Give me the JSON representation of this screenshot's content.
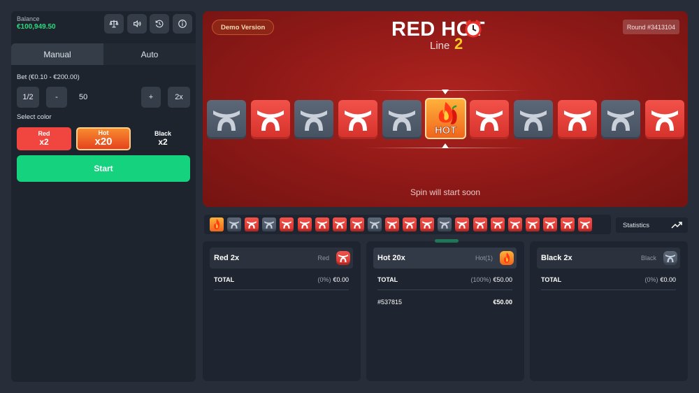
{
  "balance": {
    "label": "Balance",
    "value": "€100,949.50"
  },
  "toolbar": {
    "icons": [
      "scales-icon",
      "sound-icon",
      "history-icon",
      "info-icon"
    ]
  },
  "tabs": {
    "manual": "Manual",
    "auto": "Auto"
  },
  "bet": {
    "label": "Bet (€0.10 - €200.00)",
    "half": "1/2",
    "minus": "-",
    "value": "50",
    "plus": "+",
    "double": "2x"
  },
  "colors": {
    "label": "Select color",
    "red": {
      "name": "Red",
      "multiplier": "x2"
    },
    "hot": {
      "name": "Hot",
      "multiplier": "x20"
    },
    "black": {
      "name": "Black",
      "multiplier": "x2"
    }
  },
  "start_label": "Start",
  "game": {
    "demo_label": "Demo Version",
    "round_label": "Round #3413104",
    "logo_main": "RED HOT",
    "logo_sub": "Line",
    "logo_num": "2",
    "status": "Spin will start soon",
    "hot_text": "HOT",
    "reel": [
      "gray",
      "red",
      "gray",
      "red",
      "gray",
      "hot",
      "red",
      "gray",
      "red",
      "gray",
      "red"
    ],
    "palette": {
      "red": "#e53a32",
      "gray": "#525d6d",
      "hot": "#f58a25",
      "accent_green": "#14d27d"
    }
  },
  "history": [
    "hot",
    "gray",
    "red",
    "gray",
    "red",
    "red",
    "red",
    "red",
    "red",
    "gray",
    "red",
    "red",
    "red",
    "gray",
    "red",
    "red",
    "red",
    "red",
    "red",
    "red",
    "red",
    "red"
  ],
  "stats_label": "Statistics",
  "panels": {
    "red": {
      "title": "Red 2x",
      "tag": "Red",
      "total_label": "TOTAL",
      "total_pct": "(0%)",
      "total_amount": "€0.00"
    },
    "hot": {
      "title": "Hot 20x",
      "tag": "Hot(1)",
      "total_label": "TOTAL",
      "total_pct": "(100%)",
      "total_amount": "€50.00",
      "bets": [
        {
          "id": "#537815",
          "amount": "€50.00"
        }
      ]
    },
    "black": {
      "title": "Black 2x",
      "tag": "Black",
      "total_label": "TOTAL",
      "total_pct": "(0%)",
      "total_amount": "€0.00"
    }
  }
}
